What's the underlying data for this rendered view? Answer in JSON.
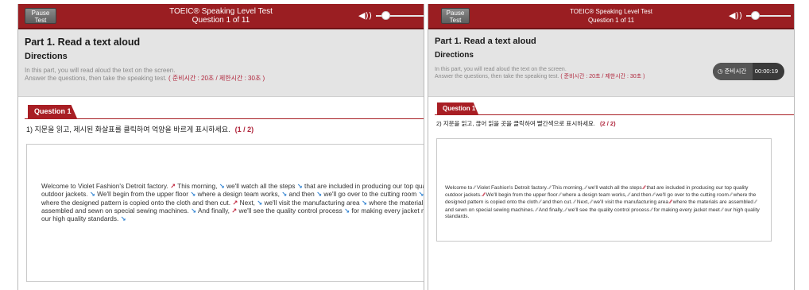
{
  "left": {
    "pause_label_1": "Pause",
    "pause_label_2": "Test",
    "title": "TOEIC® Speaking Level Test",
    "subtitle": "Question 1 of 11",
    "volume_level": 0.2,
    "part_title": "Part 1. Read a text aloud",
    "directions": "Directions",
    "dir_line1": "In this part, you will read aloud the text on the screen.",
    "dir_line2": "Answer the questions, then take the speaking test.",
    "dir_time": "( 준비시간 : 20초 / 제한시간 : 30초 )",
    "question_tab": "Question 1",
    "instruction": "1) 지문을 읽고, 제시된 화살표를 클릭하여 억양을 바르게 표시하세요.",
    "page": "(1 / 2)",
    "segments": [
      {
        "t": "Welcome to Violet Fashion's Detroit factory. "
      },
      {
        "m": "↗",
        "c": "red"
      },
      {
        "t": " This morning, "
      },
      {
        "m": "↘",
        "c": "blue"
      },
      {
        "t": " we'll watch all the steps "
      },
      {
        "m": "↘",
        "c": "blue"
      },
      {
        "t": " that are included in producing our top quality outdoor jackets. "
      },
      {
        "m": "↘",
        "c": "blue"
      },
      {
        "t": " We'll begin from the upper floor "
      },
      {
        "m": "↘",
        "c": "blue"
      },
      {
        "t": " where a design team works, "
      },
      {
        "m": "↘",
        "c": "blue"
      },
      {
        "t": " and then "
      },
      {
        "m": "↘",
        "c": "blue"
      },
      {
        "t": " we'll go over to the cutting room "
      },
      {
        "m": "↘",
        "c": "blue"
      },
      {
        "t": " where the designed pattern is copied onto the cloth and then cut. "
      },
      {
        "m": "↗",
        "c": "red"
      },
      {
        "t": " Next, "
      },
      {
        "m": "↘",
        "c": "blue"
      },
      {
        "t": " we'll visit the manufacturing area "
      },
      {
        "m": "↘",
        "c": "blue"
      },
      {
        "t": " where the materials are assembled and sewn on special sewing machines. "
      },
      {
        "m": "↘",
        "c": "blue"
      },
      {
        "t": " And finally, "
      },
      {
        "m": "↗",
        "c": "red"
      },
      {
        "t": " we'll see the quality control process "
      },
      {
        "m": "↘",
        "c": "blue"
      },
      {
        "t": " for making every jacket meet our high quality standards. "
      },
      {
        "m": "↘",
        "c": "blue"
      }
    ]
  },
  "right": {
    "pause_label_1": "Pause",
    "pause_label_2": "Test",
    "title": "TOEIC® Speaking Level Test",
    "subtitle": "Question 1 of 11",
    "volume_level": 0.2,
    "part_title": "Part 1. Read a text aloud",
    "directions": "Directions",
    "dir_line1": "In this part, you will read aloud the text on the screen.",
    "dir_line2": "Answer the questions, then take the speaking test.",
    "dir_time": "( 준비시간 : 20초 / 제한시간 : 30초 )",
    "timer_label": "준비시간",
    "timer_value": "00:00:19",
    "question_tab": "Question 1",
    "instruction": "2) 지문을 읽고, 끊어 읽을 곳을 클릭하여 빨간색으로 표시하세요.",
    "page": "(2 / 2)",
    "segments": [
      {
        "t": "Welcome to "
      },
      {
        "m": "⁄⁄",
        "c": "blue"
      },
      {
        "t": " Violet Fashion's Detroit factory. "
      },
      {
        "m": "⁄⁄",
        "c": "blue"
      },
      {
        "t": " This morning, "
      },
      {
        "m": "⁄⁄",
        "c": "blue"
      },
      {
        "t": " we'll watch all the steps "
      },
      {
        "m": "⁄⁄",
        "c": "red"
      },
      {
        "t": " that are included in producing our top quality outdoor jackets. "
      },
      {
        "m": "⁄⁄",
        "c": "red"
      },
      {
        "t": " We'll begin from the upper floor "
      },
      {
        "m": "⁄⁄",
        "c": "blue"
      },
      {
        "t": " where a design team works, "
      },
      {
        "m": "⁄⁄",
        "c": "blue"
      },
      {
        "t": " and then "
      },
      {
        "m": "⁄⁄",
        "c": "blue"
      },
      {
        "t": " we'll go over to the cutting room "
      },
      {
        "m": "⁄⁄",
        "c": "blue"
      },
      {
        "t": " where the designed pattern is copied onto the cloth "
      },
      {
        "m": "⁄⁄",
        "c": "blue"
      },
      {
        "t": " and then cut. "
      },
      {
        "m": "⁄⁄",
        "c": "blue"
      },
      {
        "t": " Next, "
      },
      {
        "m": "⁄⁄",
        "c": "blue"
      },
      {
        "t": " we'll visit the manufacturing area "
      },
      {
        "m": "⁄⁄",
        "c": "red"
      },
      {
        "t": " where the materials are assembled "
      },
      {
        "m": "⁄⁄",
        "c": "blue"
      },
      {
        "t": " and sewn on special sewing machines. "
      },
      {
        "m": "⁄⁄",
        "c": "blue"
      },
      {
        "t": " And finally, "
      },
      {
        "m": "⁄⁄",
        "c": "blue"
      },
      {
        "t": " we'll see the quality control process "
      },
      {
        "m": "⁄⁄",
        "c": "blue"
      },
      {
        "t": " for making every jacket meet "
      },
      {
        "m": "⁄⁄",
        "c": "blue"
      },
      {
        "t": " our high quality standards."
      }
    ]
  }
}
